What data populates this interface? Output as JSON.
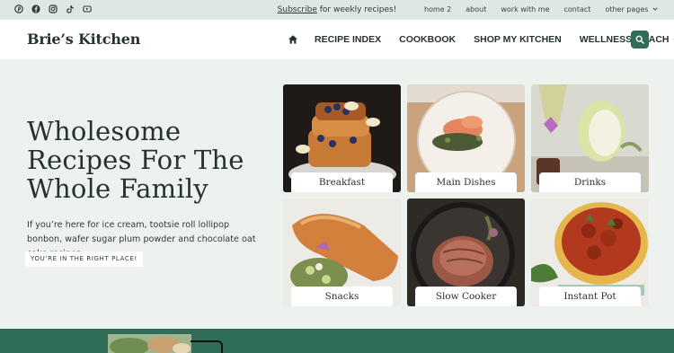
{
  "topbar": {
    "social_icons": [
      "pinterest-icon",
      "facebook-icon",
      "instagram-icon",
      "tiktok-icon",
      "youtube-icon"
    ],
    "promo_link": "Subscribe",
    "promo_rest": " for weekly recipes!",
    "nav": [
      "home 2",
      "about",
      "work with me",
      "contact",
      "other pages"
    ]
  },
  "header": {
    "brand": "Brie’s Kitchen",
    "nav": [
      "RECIPE INDEX",
      "COOKBOOK",
      "SHOP MY KITCHEN",
      "WELLNESS COACH"
    ],
    "accent_color": "#2f6d58"
  },
  "hero": {
    "title_line1": "Wholesome",
    "title_line2": "Recipes For The",
    "title_line3": "Whole Family",
    "description": "If you’re here for ice cream, tootsie roll lollipop bonbon, wafer sugar plum powder and chocolate oat cake recipes….",
    "badge": "YOU’RE IN THE RIGHT PLACE!"
  },
  "categories": [
    "Breakfast",
    "Main Dishes",
    "Drinks",
    "Snacks",
    "Slow Cooker",
    "Instant Pot"
  ]
}
